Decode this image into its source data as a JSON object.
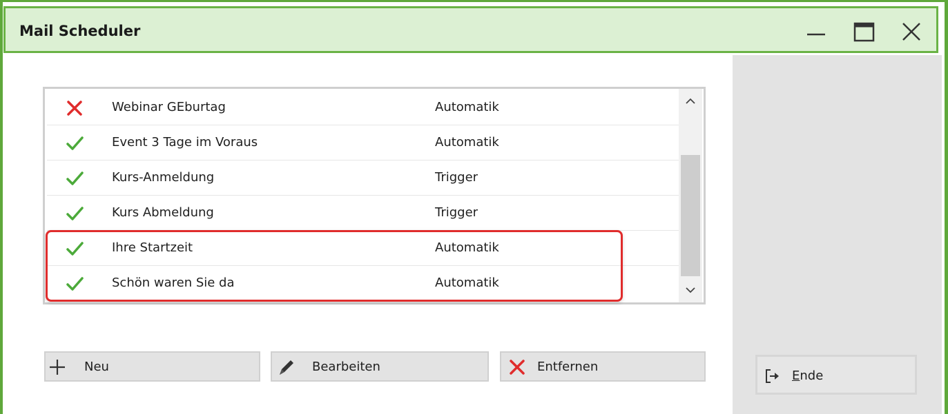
{
  "window": {
    "title": "Mail Scheduler",
    "controls": [
      "minimize-icon",
      "maximize-icon",
      "close-icon"
    ],
    "accent_color": "#5fa83b"
  },
  "list": {
    "rows": [
      {
        "status": "inactive",
        "status_icon": "x-icon",
        "name": "Webinar GEburtag",
        "type": "Automatik"
      },
      {
        "status": "active",
        "status_icon": "check-icon",
        "name": "Event 3 Tage im Voraus",
        "type": "Automatik"
      },
      {
        "status": "active",
        "status_icon": "check-icon",
        "name": "Kurs-Anmeldung",
        "type": "Trigger"
      },
      {
        "status": "active",
        "status_icon": "check-icon",
        "name": "Kurs Abmeldung",
        "type": "Trigger"
      },
      {
        "status": "active",
        "status_icon": "check-icon",
        "name": "Ihre Startzeit",
        "type": "Automatik"
      },
      {
        "status": "active",
        "status_icon": "check-icon",
        "name": "Schön waren Sie da",
        "type": "Automatik"
      }
    ],
    "highlight_color": "#e02c2c",
    "check_color": "#4caa3a",
    "x_color": "#e02c2c"
  },
  "buttons": {
    "new_label": "Neu",
    "edit_label": "Bearbeiten",
    "remove_label": "Entfernen",
    "end_label": "Ende"
  }
}
